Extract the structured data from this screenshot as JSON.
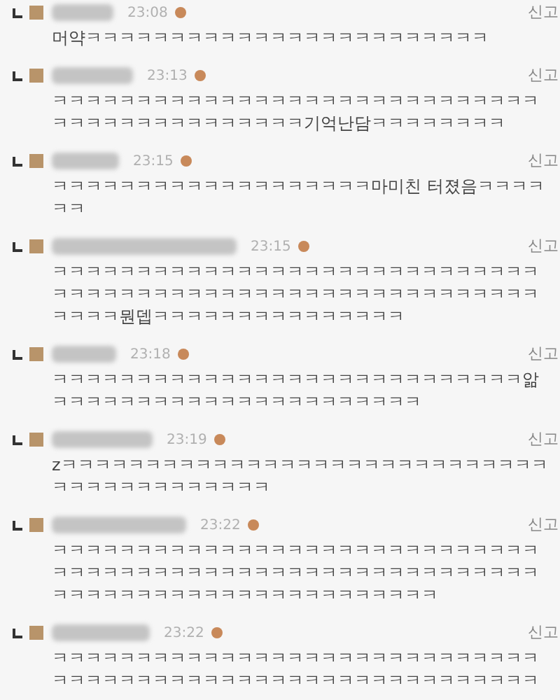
{
  "comments": [
    {
      "time": "23:08",
      "report": "신고",
      "text": "머약ㅋㅋㅋㅋㅋㅋㅋㅋㅋㅋㅋㅋㅋㅋㅋㅋㅋㅋㅋㅋㅋㅋㅋㅋ"
    },
    {
      "time": "23:13",
      "report": "신고",
      "text": "ㅋㅋㅋㅋㅋㅋㅋㅋㅋㅋㅋㅋㅋㅋㅋㅋㅋㅋㅋㅋㅋㅋㅋㅋㅋㅋㅋㅋㅋㅋㅋㅋㅋㅋㅋㅋㅋㅋㅋㅋㅋㅋㅋㅋ기억난담ㅋㅋㅋㅋㅋㅋㅋㅋ"
    },
    {
      "time": "23:15",
      "report": "신고",
      "text": "ㅋㅋㅋㅋㅋㅋㅋㅋㅋㅋㅋㅋㅋㅋㅋㅋㅋㅋㅋ마미친 터졌음ㅋㅋㅋㅋㅋㅋ"
    },
    {
      "time": "23:15",
      "report": "신고",
      "text": "ㅋㅋㅋㅋㅋㅋㅋㅋㅋㅋㅋㅋㅋㅋㅋㅋㅋㅋㅋㅋㅋㅋㅋㅋㅋㅋㅋㅋㅋㅋㅋㅋㅋㅋㅋㅋㅋㅋㅋㅋㅋㅋㅋㅋㅋㅋㅋㅋㅋㅋㅋㅋㅋㅋㅋㅋㅋㅋㅋㅋㅋㅋ뭔뎁ㅋㅋㅋㅋㅋㅋㅋㅋㅋㅋㅋㅋㅋㅋㅋ"
    },
    {
      "time": "23:18",
      "report": "신고",
      "text": "ㅋㅋㅋㅋㅋㅋㅋㅋㅋㅋㅋㅋㅋㅋㅋㅋㅋㅋㅋㅋㅋㅋㅋㅋㅋㅋㅋㅋ앎ㅋㅋㅋㅋㅋㅋㅋㅋㅋㅋㅋㅋㅋㅋㅋㅋㅋㅋㅋㅋㅋㅋ"
    },
    {
      "time": "23:19",
      "report": "신고",
      "text": "zㅋㅋㅋㅋㅋㅋㅋㅋㅋㅋㅋㅋㅋㅋㅋㅋㅋㅋㅋㅋㅋㅋㅋㅋㅋㅋㅋㅋㅋㅋㅋㅋㅋㅋㅋㅋㅋㅋㅋㅋㅋㅋ"
    },
    {
      "time": "23:22",
      "report": "신고",
      "text": "ㅋㅋㅋㅋㅋㅋㅋㅋㅋㅋㅋㅋㅋㅋㅋㅋㅋㅋㅋㅋㅋㅋㅋㅋㅋㅋㅋㅋㅋㅋㅋㅋㅋㅋㅋㅋㅋㅋㅋㅋㅋㅋㅋㅋㅋㅋㅋㅋㅋㅋㅋㅋㅋㅋㅋㅋㅋㅋㅋㅋㅋㅋㅋㅋㅋㅋㅋㅋㅋㅋㅋㅋㅋㅋㅋㅋㅋㅋㅋㅋㅋ"
    },
    {
      "time": "23:22",
      "report": "신고",
      "text": "ㅋㅋㅋㅋㅋㅋㅋㅋㅋㅋㅋㅋㅋㅋㅋㅋㅋㅋㅋㅋㅋㅋㅋㅋㅋㅋㅋㅋㅋㅋㅋㅋㅋㅋㅋㅋㅋㅋㅋㅋㅋㅋㅋㅋㅋㅋㅋㅋㅋㅋㅋㅋㅋㅋㅋㅋㅋㅋ"
    }
  ]
}
